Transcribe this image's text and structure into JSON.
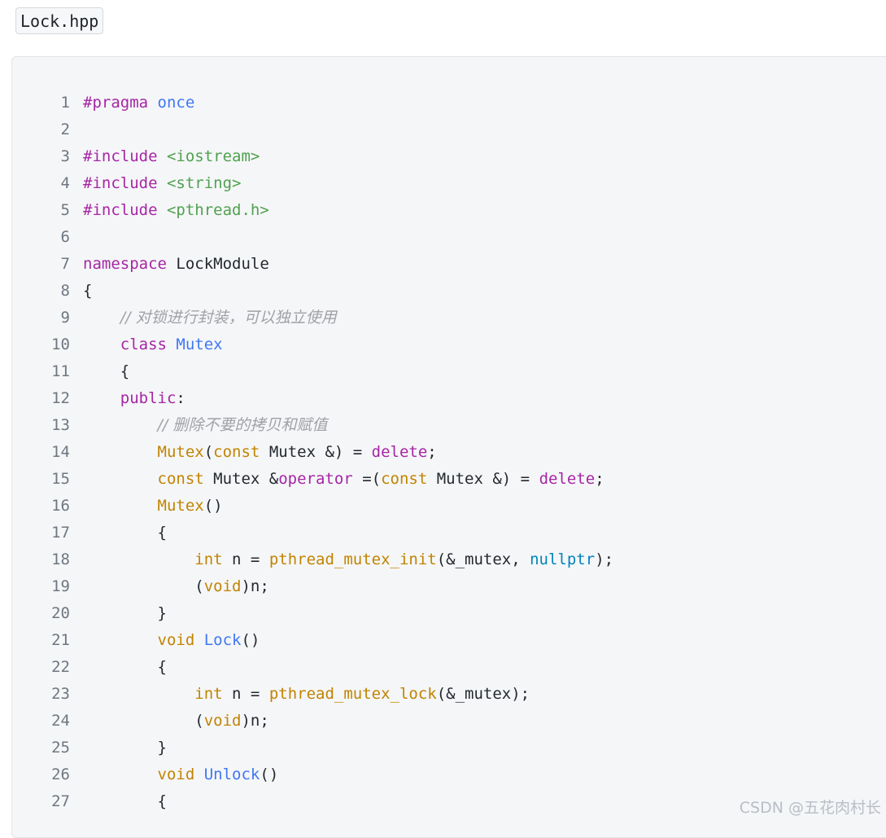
{
  "file": {
    "name": "Lock.hpp"
  },
  "code": {
    "lines": [
      {
        "n": "1",
        "tokens": [
          {
            "t": "#pragma",
            "c": "pp"
          },
          {
            "t": " ",
            "c": "pl"
          },
          {
            "t": "once",
            "c": "once"
          }
        ]
      },
      {
        "n": "2",
        "tokens": []
      },
      {
        "n": "3",
        "tokens": [
          {
            "t": "#include",
            "c": "pp"
          },
          {
            "t": " ",
            "c": "pl"
          },
          {
            "t": "<iostream>",
            "c": "str"
          }
        ]
      },
      {
        "n": "4",
        "tokens": [
          {
            "t": "#include",
            "c": "pp"
          },
          {
            "t": " ",
            "c": "pl"
          },
          {
            "t": "<string>",
            "c": "str"
          }
        ]
      },
      {
        "n": "5",
        "tokens": [
          {
            "t": "#include",
            "c": "pp"
          },
          {
            "t": " ",
            "c": "pl"
          },
          {
            "t": "<pthread.h>",
            "c": "str"
          }
        ]
      },
      {
        "n": "6",
        "tokens": []
      },
      {
        "n": "7",
        "tokens": [
          {
            "t": "namespace",
            "c": "kw"
          },
          {
            "t": " LockModule",
            "c": "pl"
          }
        ]
      },
      {
        "n": "8",
        "tokens": [
          {
            "t": "{",
            "c": "pl"
          }
        ]
      },
      {
        "n": "9",
        "tokens": [
          {
            "t": "    ",
            "c": "pl"
          },
          {
            "t": "// 对锁进行封装，可以独立使用",
            "c": "com"
          }
        ]
      },
      {
        "n": "10",
        "tokens": [
          {
            "t": "    ",
            "c": "pl"
          },
          {
            "t": "class",
            "c": "kw"
          },
          {
            "t": " ",
            "c": "pl"
          },
          {
            "t": "Mutex",
            "c": "fn-blue"
          }
        ]
      },
      {
        "n": "11",
        "tokens": [
          {
            "t": "    {",
            "c": "pl"
          }
        ]
      },
      {
        "n": "12",
        "tokens": [
          {
            "t": "    ",
            "c": "pl"
          },
          {
            "t": "public",
            "c": "kw"
          },
          {
            "t": ":",
            "c": "pl"
          }
        ]
      },
      {
        "n": "13",
        "tokens": [
          {
            "t": "        ",
            "c": "pl"
          },
          {
            "t": "// 删除不要的拷贝和赋值",
            "c": "com"
          }
        ]
      },
      {
        "n": "14",
        "tokens": [
          {
            "t": "        ",
            "c": "pl"
          },
          {
            "t": "Mutex",
            "c": "call"
          },
          {
            "t": "(",
            "c": "pl"
          },
          {
            "t": "const",
            "c": "type"
          },
          {
            "t": " Mutex &) = ",
            "c": "pl"
          },
          {
            "t": "delete",
            "c": "kw"
          },
          {
            "t": ";",
            "c": "pl"
          }
        ]
      },
      {
        "n": "15",
        "tokens": [
          {
            "t": "        ",
            "c": "pl"
          },
          {
            "t": "const",
            "c": "type"
          },
          {
            "t": " Mutex &",
            "c": "pl"
          },
          {
            "t": "operator",
            "c": "kw"
          },
          {
            "t": " =(",
            "c": "pl"
          },
          {
            "t": "const",
            "c": "type"
          },
          {
            "t": " Mutex &) = ",
            "c": "pl"
          },
          {
            "t": "delete",
            "c": "kw"
          },
          {
            "t": ";",
            "c": "pl"
          }
        ]
      },
      {
        "n": "16",
        "tokens": [
          {
            "t": "        ",
            "c": "pl"
          },
          {
            "t": "Mutex",
            "c": "call"
          },
          {
            "t": "()",
            "c": "pl"
          }
        ]
      },
      {
        "n": "17",
        "tokens": [
          {
            "t": "        {",
            "c": "pl"
          }
        ]
      },
      {
        "n": "18",
        "tokens": [
          {
            "t": "            ",
            "c": "pl"
          },
          {
            "t": "int",
            "c": "type"
          },
          {
            "t": " n = ",
            "c": "pl"
          },
          {
            "t": "pthread_mutex_init",
            "c": "call"
          },
          {
            "t": "(&_mutex, ",
            "c": "pl"
          },
          {
            "t": "nullptr",
            "c": "lit"
          },
          {
            "t": ");",
            "c": "pl"
          }
        ]
      },
      {
        "n": "19",
        "tokens": [
          {
            "t": "            (",
            "c": "pl"
          },
          {
            "t": "void",
            "c": "type"
          },
          {
            "t": ")n;",
            "c": "pl"
          }
        ]
      },
      {
        "n": "20",
        "tokens": [
          {
            "t": "        }",
            "c": "pl"
          }
        ]
      },
      {
        "n": "21",
        "tokens": [
          {
            "t": "        ",
            "c": "pl"
          },
          {
            "t": "void",
            "c": "type"
          },
          {
            "t": " ",
            "c": "pl"
          },
          {
            "t": "Lock",
            "c": "fn-blue"
          },
          {
            "t": "()",
            "c": "pl"
          }
        ]
      },
      {
        "n": "22",
        "tokens": [
          {
            "t": "        {",
            "c": "pl"
          }
        ]
      },
      {
        "n": "23",
        "tokens": [
          {
            "t": "            ",
            "c": "pl"
          },
          {
            "t": "int",
            "c": "type"
          },
          {
            "t": " n = ",
            "c": "pl"
          },
          {
            "t": "pthread_mutex_lock",
            "c": "call"
          },
          {
            "t": "(&_mutex);",
            "c": "pl"
          }
        ]
      },
      {
        "n": "24",
        "tokens": [
          {
            "t": "            (",
            "c": "pl"
          },
          {
            "t": "void",
            "c": "type"
          },
          {
            "t": ")n;",
            "c": "pl"
          }
        ]
      },
      {
        "n": "25",
        "tokens": [
          {
            "t": "        }",
            "c": "pl"
          }
        ]
      },
      {
        "n": "26",
        "tokens": [
          {
            "t": "        ",
            "c": "pl"
          },
          {
            "t": "void",
            "c": "type"
          },
          {
            "t": " ",
            "c": "pl"
          },
          {
            "t": "Unlock",
            "c": "fn-blue"
          },
          {
            "t": "()",
            "c": "pl"
          }
        ]
      },
      {
        "n": "27",
        "tokens": [
          {
            "t": "        {",
            "c": "pl"
          }
        ]
      }
    ]
  },
  "watermark": {
    "text": "CSDN @五花肉村长"
  },
  "colors": {
    "keyword": "#a626a4",
    "string": "#50a14f",
    "type": "#c18401",
    "function": "#4078f2",
    "literal": "#0184bc",
    "comment": "#a0a1a7",
    "line_number": "#6e7781",
    "background": "#f5f6f8"
  }
}
